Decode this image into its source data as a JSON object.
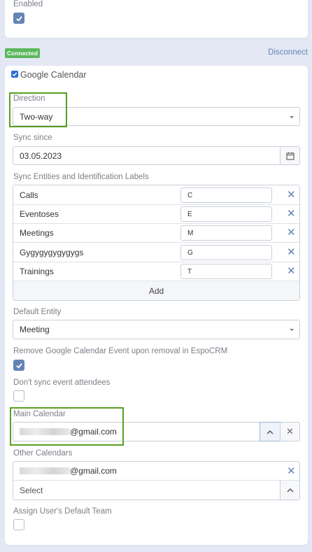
{
  "top_panel": {
    "enabled_label": "Enabled",
    "enabled_checked": true
  },
  "status": {
    "badge": "Connected",
    "disconnect_link": "Disconnect",
    "badge_color": "#5cb85c"
  },
  "google_calendar": {
    "title": "Google Calendar",
    "checked": true,
    "direction": {
      "label": "Direction",
      "value": "Two-way"
    },
    "sync_since": {
      "label": "Sync since",
      "value": "03.05.2023"
    },
    "entities": {
      "label": "Sync Entities and Identification Labels",
      "rows": [
        {
          "name": "Calls",
          "code": "C"
        },
        {
          "name": "Eventoses",
          "code": "E"
        },
        {
          "name": "Meetings",
          "code": "M"
        },
        {
          "name": "Gygygygygygygs",
          "code": "G"
        },
        {
          "name": "Trainings",
          "code": "T"
        }
      ],
      "add_label": "Add"
    },
    "default_entity": {
      "label": "Default Entity",
      "value": "Meeting"
    },
    "remove_event": {
      "label": "Remove Google Calendar Event upon removal in EspoCRM",
      "checked": true
    },
    "dont_sync_attendees": {
      "label": "Don't sync event attendees",
      "checked": false
    },
    "main_calendar": {
      "label": "Main Calendar",
      "value_suffix": "@gmail.com"
    },
    "other_calendars": {
      "label": "Other Calendars",
      "value_suffix": "@gmail.com",
      "select_placeholder": "Select"
    },
    "assign_team": {
      "label": "Assign User's Default Team",
      "checked": false
    }
  },
  "colors": {
    "accent": "#6384b5",
    "highlight": "#5aa01e",
    "background": "#e4e8f5"
  }
}
